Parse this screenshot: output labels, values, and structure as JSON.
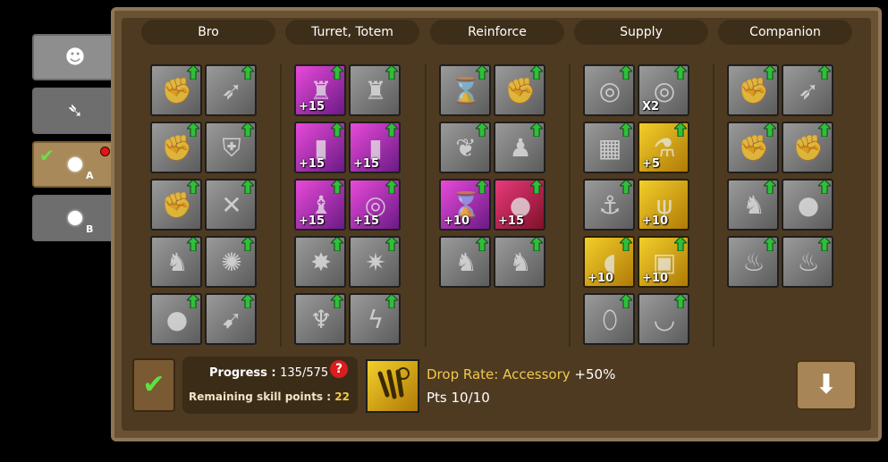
{
  "tabs": [
    {
      "icon": "bro-face-icon",
      "glyph": "☻",
      "selected": false
    },
    {
      "icon": "lightning-icon",
      "glyph": "➴",
      "selected": false
    },
    {
      "icon": "circle-icon",
      "sub": "A",
      "selected": true,
      "checked": true,
      "notification": true
    },
    {
      "icon": "circle-icon",
      "sub": "B",
      "selected": false
    }
  ],
  "columns": [
    {
      "title": "Bro",
      "cells": [
        {
          "col": 0,
          "row": 0,
          "style": "gray",
          "icon": "punch-icon",
          "upgradable": true
        },
        {
          "col": 1,
          "row": 0,
          "style": "gray",
          "icon": "dash-icon",
          "upgradable": true
        },
        {
          "col": 0,
          "row": 1,
          "style": "gray",
          "icon": "fist-percent-icon",
          "upgradable": true
        },
        {
          "col": 1,
          "row": 1,
          "style": "gray",
          "icon": "shield-icon",
          "upgradable": true
        },
        {
          "col": 0,
          "row": 2,
          "style": "gray",
          "icon": "fist-icon",
          "upgradable": true
        },
        {
          "col": 1,
          "row": 2,
          "style": "gray",
          "icon": "slash-icon",
          "upgradable": true
        },
        {
          "col": 0,
          "row": 3,
          "style": "gray",
          "icon": "warrior-icon",
          "upgradable": true
        },
        {
          "col": 1,
          "row": 3,
          "style": "gray",
          "icon": "spin-icon",
          "upgradable": true
        },
        {
          "col": 0,
          "row": 4,
          "style": "gray",
          "icon": "bomb-icon",
          "upgradable": true
        },
        {
          "col": 1,
          "row": 4,
          "style": "gray",
          "icon": "beam-icon",
          "upgradable": true
        }
      ]
    },
    {
      "title": "Turret, Totem",
      "cells": [
        {
          "col": 0,
          "row": 0,
          "style": "pink",
          "icon": "turret-icon",
          "label": "+15",
          "upgradable": true
        },
        {
          "col": 1,
          "row": 0,
          "style": "gray",
          "icon": "turret-dash-icon",
          "upgradable": true
        },
        {
          "col": 0,
          "row": 1,
          "style": "pink",
          "icon": "laser-percent-icon",
          "label": "+15",
          "upgradable": true
        },
        {
          "col": 1,
          "row": 1,
          "style": "pink",
          "icon": "laser-icon",
          "label": "+15",
          "upgradable": true
        },
        {
          "col": 0,
          "row": 2,
          "style": "pink",
          "icon": "totem-icon",
          "label": "+15",
          "upgradable": true
        },
        {
          "col": 1,
          "row": 2,
          "style": "pink",
          "icon": "target-icon",
          "label": "+15",
          "upgradable": true
        },
        {
          "col": 0,
          "row": 3,
          "style": "gray",
          "icon": "blast-icon",
          "upgradable": true
        },
        {
          "col": 1,
          "row": 3,
          "style": "gray",
          "icon": "burst-icon",
          "upgradable": true
        },
        {
          "col": 0,
          "row": 4,
          "style": "gray",
          "icon": "antler-totem-icon",
          "upgradable": true
        },
        {
          "col": 1,
          "row": 4,
          "style": "gray",
          "icon": "spark-icon",
          "upgradable": true
        }
      ]
    },
    {
      "title": "Reinforce",
      "cells": [
        {
          "col": 0,
          "row": 0,
          "style": "gray",
          "icon": "hourglass-figure-icon",
          "upgradable": true
        },
        {
          "col": 1,
          "row": 0,
          "style": "gray",
          "icon": "raised-fist-icon",
          "upgradable": true
        },
        {
          "col": 0,
          "row": 1,
          "style": "gray",
          "icon": "wings-icon",
          "upgradable": true
        },
        {
          "col": 1,
          "row": 1,
          "style": "gray",
          "icon": "muscle-icon",
          "upgradable": true
        },
        {
          "col": 0,
          "row": 2,
          "style": "pink",
          "icon": "hourglass-icon",
          "label": "+10",
          "upgradable": true
        },
        {
          "col": 1,
          "row": 2,
          "style": "red",
          "icon": "blob-icon",
          "label": "+15",
          "upgradable": true
        },
        {
          "col": 0,
          "row": 3,
          "style": "gray",
          "icon": "dino-arrow-icon",
          "upgradable": true
        },
        {
          "col": 1,
          "row": 3,
          "style": "gray",
          "icon": "dino-icon",
          "upgradable": true
        }
      ]
    },
    {
      "title": "Supply",
      "cells": [
        {
          "col": 0,
          "row": 0,
          "style": "gray",
          "icon": "donut-icon",
          "upgradable": true
        },
        {
          "col": 1,
          "row": 0,
          "style": "gray",
          "icon": "donut-x2-icon",
          "label": "X2",
          "upgradable": true
        },
        {
          "col": 0,
          "row": 1,
          "style": "gray",
          "icon": "crate-percent-icon",
          "upgradable": true
        },
        {
          "col": 1,
          "row": 1,
          "style": "gold",
          "icon": "potion-icon",
          "label": "+5",
          "upgradable": true
        },
        {
          "col": 0,
          "row": 2,
          "style": "gray",
          "icon": "ship-icon",
          "upgradable": true
        },
        {
          "col": 1,
          "row": 2,
          "style": "gold",
          "icon": "claw-icon",
          "label": "+10",
          "upgradable": false
        },
        {
          "col": 0,
          "row": 3,
          "style": "gold",
          "icon": "cannon-icon",
          "label": "+10",
          "upgradable": true
        },
        {
          "col": 1,
          "row": 3,
          "style": "gold",
          "icon": "chest-icon",
          "label": "+10",
          "upgradable": true
        },
        {
          "col": 0,
          "row": 4,
          "style": "gray",
          "icon": "eggs-icon",
          "upgradable": true
        },
        {
          "col": 1,
          "row": 4,
          "style": "gray",
          "icon": "bowl-icon",
          "upgradable": true
        }
      ]
    },
    {
      "title": "Companion",
      "cells": [
        {
          "col": 0,
          "row": 0,
          "style": "gray",
          "icon": "punch-icon",
          "upgradable": true
        },
        {
          "col": 1,
          "row": 0,
          "style": "gray",
          "icon": "dash-icon",
          "upgradable": true
        },
        {
          "col": 0,
          "row": 1,
          "style": "gray",
          "icon": "fist-percent-icon",
          "upgradable": true
        },
        {
          "col": 1,
          "row": 1,
          "style": "gray",
          "icon": "fist-icon",
          "upgradable": true
        },
        {
          "col": 0,
          "row": 2,
          "style": "gray",
          "icon": "warrior-icon",
          "upgradable": true
        },
        {
          "col": 1,
          "row": 2,
          "style": "gray",
          "icon": "bomb-icon",
          "upgradable": true
        },
        {
          "col": 0,
          "row": 3,
          "style": "gray",
          "icon": "fire-percent-icon",
          "upgradable": true
        },
        {
          "col": 1,
          "row": 3,
          "style": "gray",
          "icon": "fire-icon",
          "upgradable": true
        }
      ]
    }
  ],
  "footer": {
    "confirm_icon": "checkmark-icon",
    "progress_label": "Progress : ",
    "progress_value": "135/575",
    "progress_current": 135,
    "progress_max": 575,
    "help_icon": "?",
    "remaining_label": "Remaining skill points : ",
    "remaining_value": "22",
    "selected_icon": "claw-icon",
    "selected_title": "Drop Rate: Accessory ",
    "selected_bonus": "+50%",
    "selected_pts": "Pts 10/10",
    "down_icon": "down-arrow-icon"
  },
  "colors": {
    "frame": "#6a5232",
    "inner": "#4d3a21",
    "accent_gold": "#f2c94c",
    "upgrade_green": "#2fbf3a"
  }
}
